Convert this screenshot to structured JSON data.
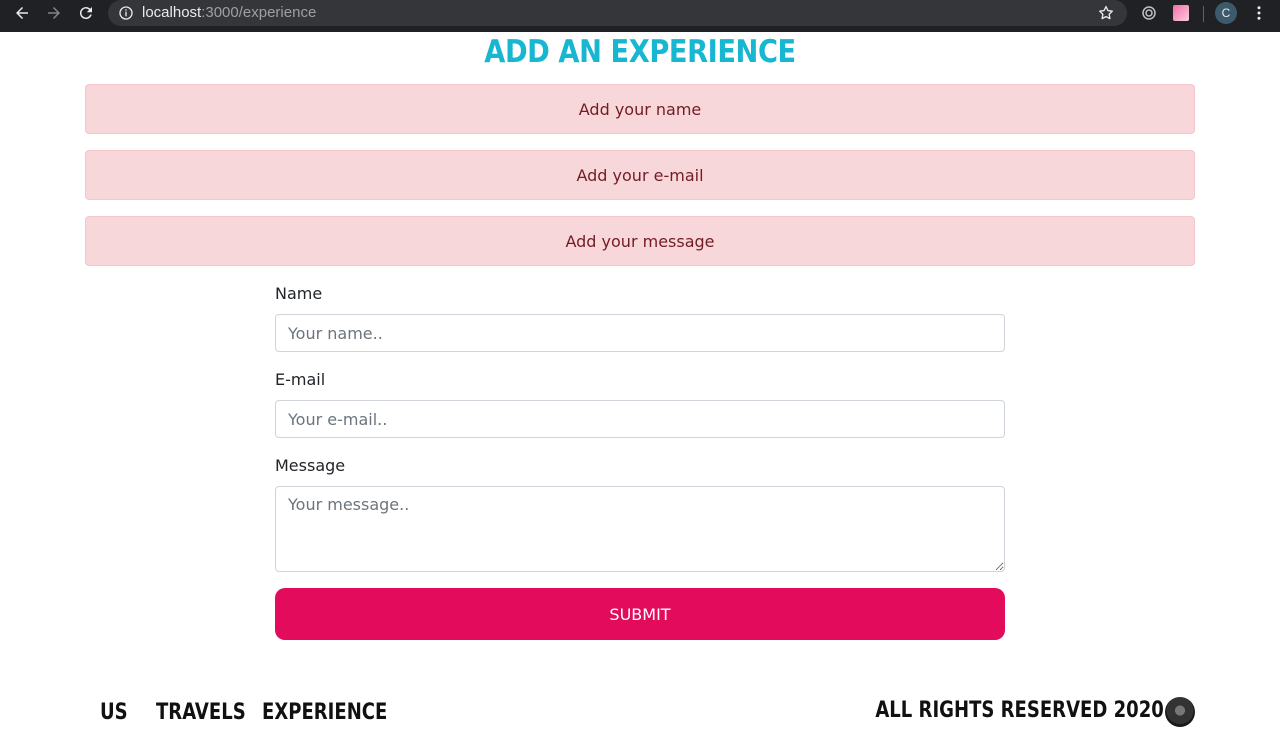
{
  "browser": {
    "url_host": "localhost",
    "url_path": ":3000/experience",
    "profile_initial": "C"
  },
  "page": {
    "title": "ADD AN EXPERIENCE",
    "title_color": "#17b6d1"
  },
  "alerts": [
    {
      "text": "Add your name"
    },
    {
      "text": "Add your e-mail"
    },
    {
      "text": "Add your message"
    }
  ],
  "form": {
    "name_label": "Name",
    "name_placeholder": "Your name..",
    "email_label": "E-mail",
    "email_placeholder": "Your e-mail..",
    "message_label": "Message",
    "message_placeholder": "Your message..",
    "submit_label": "SUBMIT",
    "submit_color": "#e20b5c"
  },
  "footer": {
    "links": [
      {
        "label": "US"
      },
      {
        "label": "TRAVELS"
      },
      {
        "label": "EXPERIENCE"
      }
    ],
    "copyright": "ALL RIGHTS RESERVED 2020"
  }
}
